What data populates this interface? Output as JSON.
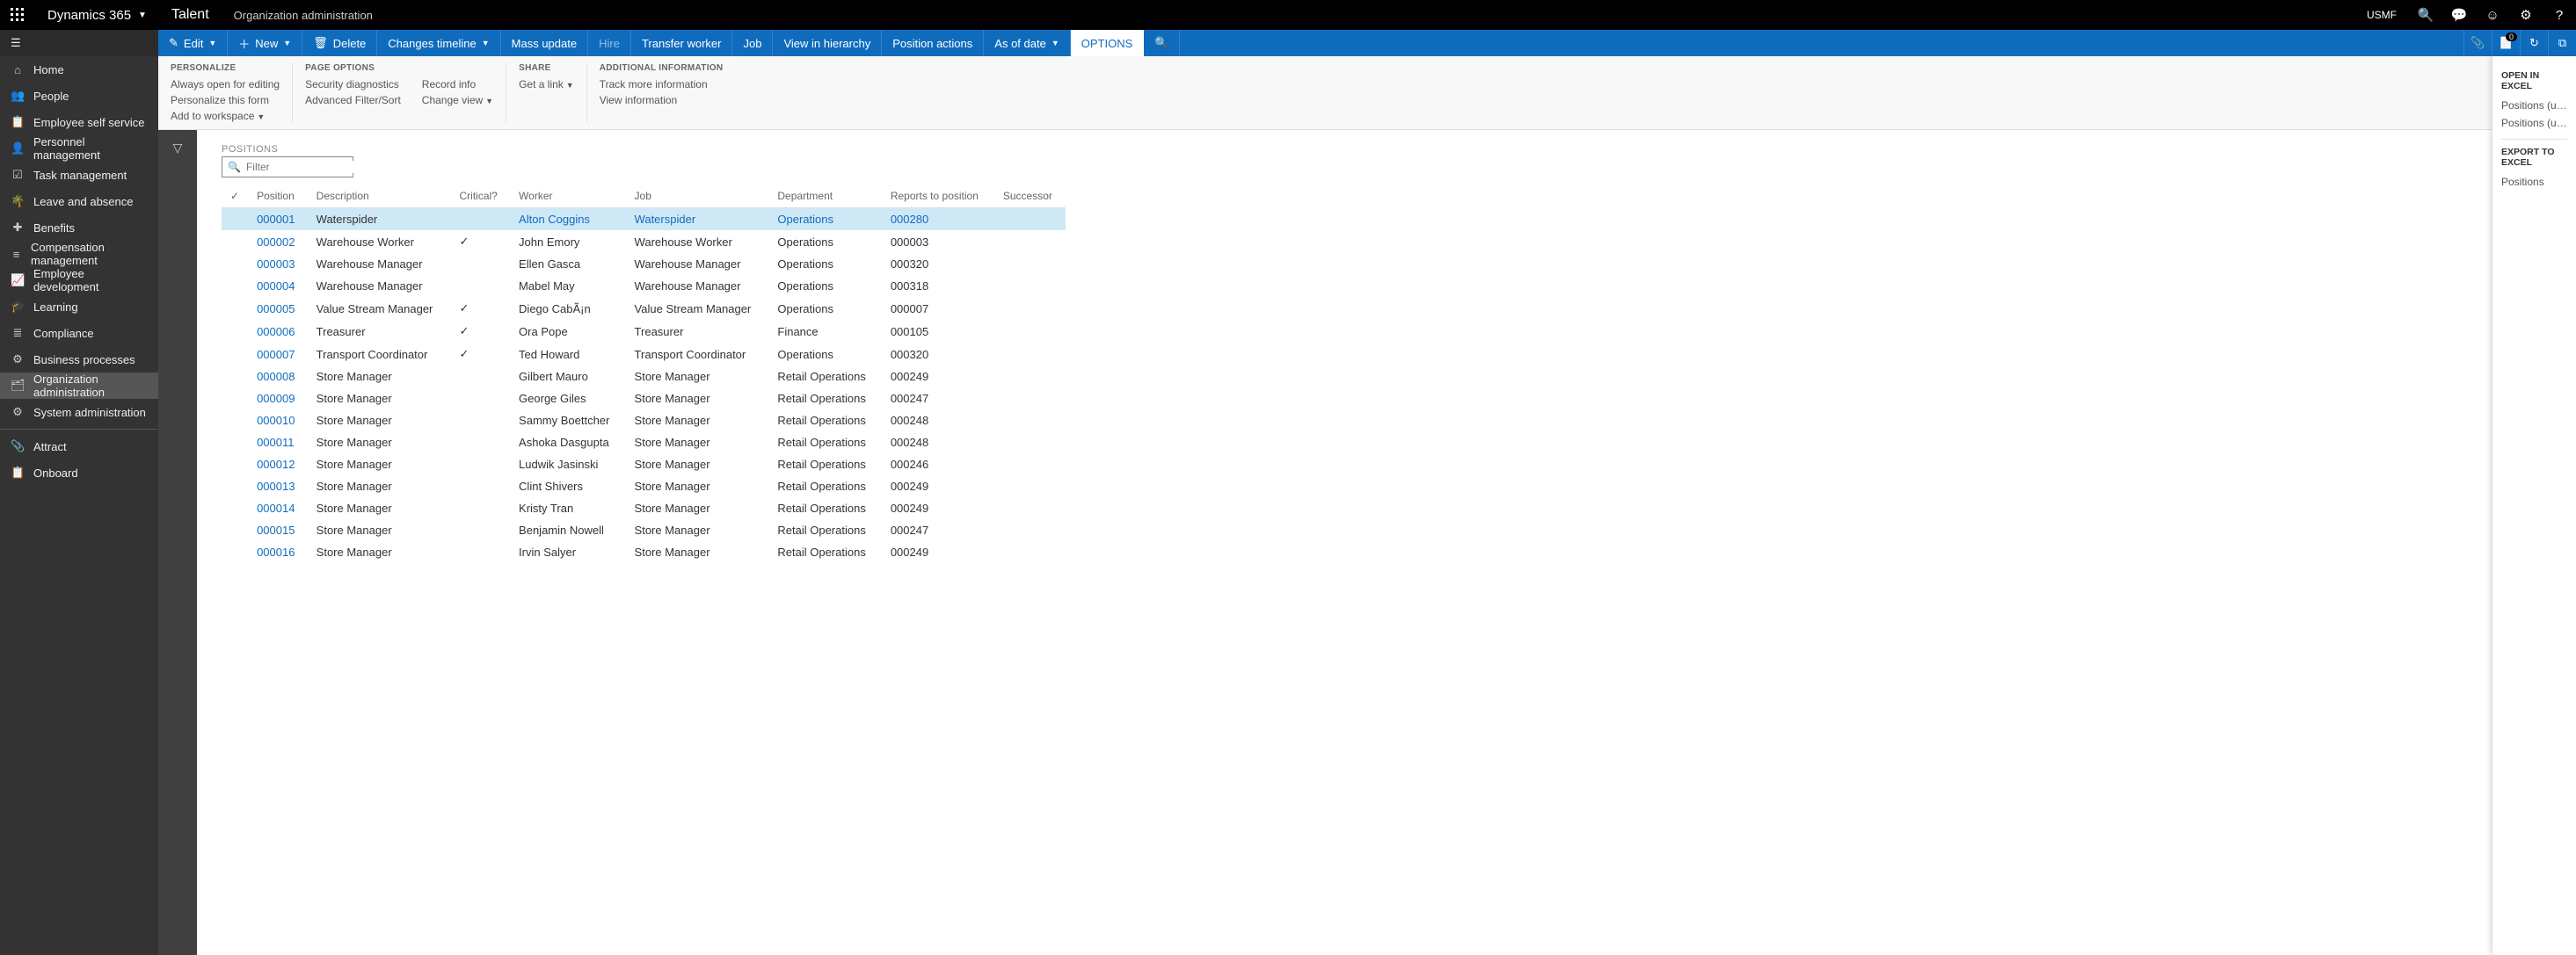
{
  "topbar": {
    "brand": "Dynamics 365",
    "app": "Talent",
    "breadcrumb": "Organization administration",
    "entity": "USMF"
  },
  "sidebar": {
    "items": [
      {
        "icon": "⌂",
        "label": "Home"
      },
      {
        "icon": "👥",
        "label": "People"
      },
      {
        "icon": "📋",
        "label": "Employee self service"
      },
      {
        "icon": "👤",
        "label": "Personnel management"
      },
      {
        "icon": "☑",
        "label": "Task management"
      },
      {
        "icon": "🌴",
        "label": "Leave and absence"
      },
      {
        "icon": "✚",
        "label": "Benefits"
      },
      {
        "icon": "≡",
        "label": "Compensation management"
      },
      {
        "icon": "📈",
        "label": "Employee development"
      },
      {
        "icon": "🎓",
        "label": "Learning"
      },
      {
        "icon": "≣",
        "label": "Compliance"
      },
      {
        "icon": "⚙",
        "label": "Business processes"
      },
      {
        "icon": "🗂",
        "label": "Organization administration"
      },
      {
        "icon": "⚙",
        "label": "System administration"
      }
    ],
    "secondary": [
      {
        "icon": "📎",
        "label": "Attract"
      },
      {
        "icon": "📋",
        "label": "Onboard"
      }
    ]
  },
  "actionbar": {
    "edit": "Edit",
    "new": "New",
    "delete": "Delete",
    "changes_timeline": "Changes timeline",
    "mass_update": "Mass update",
    "hire": "Hire",
    "transfer_worker": "Transfer worker",
    "job": "Job",
    "view_hierarchy": "View in hierarchy",
    "position_actions": "Position actions",
    "as_of_date": "As of date",
    "options": "OPTIONS",
    "badge_count": "0"
  },
  "ribbon": {
    "personalize": {
      "title": "PERSONALIZE",
      "always_open": "Always open for editing",
      "personalize_form": "Personalize this form",
      "add_workspace": "Add to workspace"
    },
    "page_options": {
      "title": "PAGE OPTIONS",
      "security_diag": "Security diagnostics",
      "adv_filter": "Advanced Filter/Sort",
      "record_info": "Record info",
      "change_view": "Change view"
    },
    "share": {
      "title": "SHARE",
      "get_link": "Get a link"
    },
    "additional": {
      "title": "ADDITIONAL INFORMATION",
      "track_more": "Track more information",
      "view_info": "View information"
    }
  },
  "flyout": {
    "open_excel_title": "OPEN IN EXCEL",
    "open_excel_items": [
      "Positions (unfiltered)",
      "Positions (unfiltered)"
    ],
    "export_excel_title": "EXPORT TO EXCEL",
    "export_excel_items": [
      "Positions"
    ]
  },
  "grid": {
    "title": "POSITIONS",
    "filter_placeholder": "Filter",
    "columns": [
      "Position",
      "Description",
      "Critical?",
      "Worker",
      "Job",
      "Department",
      "Reports to position",
      "Successor"
    ],
    "rows": [
      {
        "position": "000001",
        "description": "Waterspider",
        "critical": false,
        "worker": "Alton Coggins",
        "job": "Waterspider",
        "department": "Operations",
        "reports_to": "000280",
        "successor": "",
        "selected": true
      },
      {
        "position": "000002",
        "description": "Warehouse Worker",
        "critical": true,
        "worker": "John Emory",
        "job": "Warehouse Worker",
        "department": "Operations",
        "reports_to": "000003",
        "successor": ""
      },
      {
        "position": "000003",
        "description": "Warehouse Manager",
        "critical": false,
        "worker": "Ellen Gasca",
        "job": "Warehouse Manager",
        "department": "Operations",
        "reports_to": "000320",
        "successor": ""
      },
      {
        "position": "000004",
        "description": "Warehouse Manager",
        "critical": false,
        "worker": "Mabel May",
        "job": "Warehouse Manager",
        "department": "Operations",
        "reports_to": "000318",
        "successor": ""
      },
      {
        "position": "000005",
        "description": "Value Stream Manager",
        "critical": true,
        "worker": "Diego CabÃ¡n",
        "job": "Value Stream Manager",
        "department": "Operations",
        "reports_to": "000007",
        "successor": ""
      },
      {
        "position": "000006",
        "description": "Treasurer",
        "critical": true,
        "worker": "Ora Pope",
        "job": "Treasurer",
        "department": "Finance",
        "reports_to": "000105",
        "successor": ""
      },
      {
        "position": "000007",
        "description": "Transport Coordinator",
        "critical": true,
        "worker": "Ted Howard",
        "job": "Transport Coordinator",
        "department": "Operations",
        "reports_to": "000320",
        "successor": ""
      },
      {
        "position": "000008",
        "description": "Store Manager",
        "critical": false,
        "worker": "Gilbert Mauro",
        "job": "Store Manager",
        "department": "Retail Operations",
        "reports_to": "000249",
        "successor": ""
      },
      {
        "position": "000009",
        "description": "Store Manager",
        "critical": false,
        "worker": "George Giles",
        "job": "Store Manager",
        "department": "Retail Operations",
        "reports_to": "000247",
        "successor": ""
      },
      {
        "position": "000010",
        "description": "Store Manager",
        "critical": false,
        "worker": "Sammy Boettcher",
        "job": "Store Manager",
        "department": "Retail Operations",
        "reports_to": "000248",
        "successor": ""
      },
      {
        "position": "000011",
        "description": "Store Manager",
        "critical": false,
        "worker": "Ashoka Dasgupta",
        "job": "Store Manager",
        "department": "Retail Operations",
        "reports_to": "000248",
        "successor": ""
      },
      {
        "position": "000012",
        "description": "Store Manager",
        "critical": false,
        "worker": "Ludwik Jasinski",
        "job": "Store Manager",
        "department": "Retail Operations",
        "reports_to": "000246",
        "successor": ""
      },
      {
        "position": "000013",
        "description": "Store Manager",
        "critical": false,
        "worker": "Clint Shivers",
        "job": "Store Manager",
        "department": "Retail Operations",
        "reports_to": "000249",
        "successor": ""
      },
      {
        "position": "000014",
        "description": "Store Manager",
        "critical": false,
        "worker": "Kristy Tran",
        "job": "Store Manager",
        "department": "Retail Operations",
        "reports_to": "000249",
        "successor": ""
      },
      {
        "position": "000015",
        "description": "Store Manager",
        "critical": false,
        "worker": "Benjamin Nowell",
        "job": "Store Manager",
        "department": "Retail Operations",
        "reports_to": "000247",
        "successor": ""
      },
      {
        "position": "000016",
        "description": "Store Manager",
        "critical": false,
        "worker": "Irvin Salyer",
        "job": "Store Manager",
        "department": "Retail Operations",
        "reports_to": "000249",
        "successor": ""
      }
    ]
  }
}
